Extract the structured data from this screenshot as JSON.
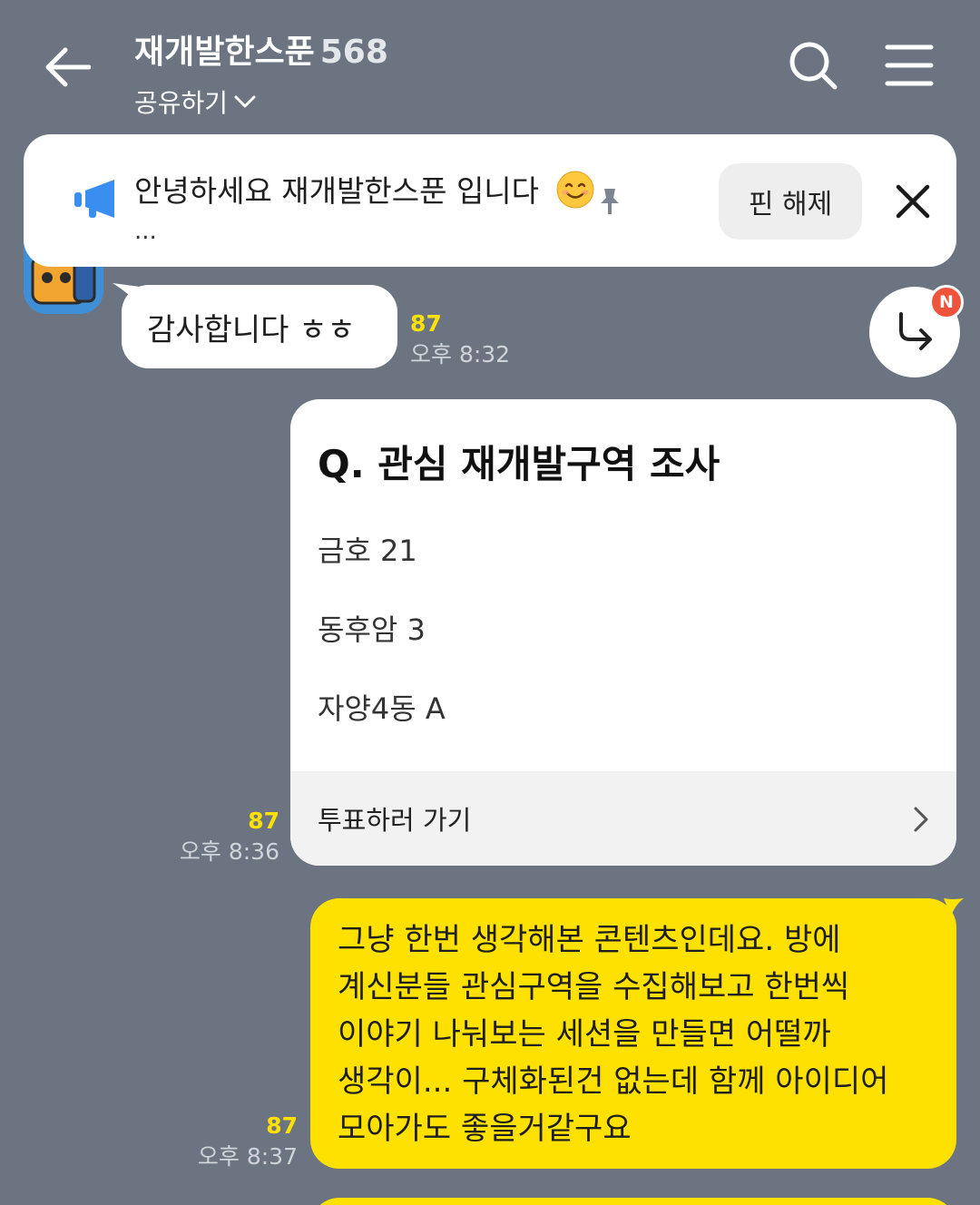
{
  "header": {
    "title": "재개발한스푼",
    "member_count": "568",
    "share_label": "공유하기"
  },
  "notice": {
    "text": "안녕하세요 재개발한스푼 입니다",
    "ellipsis": "...",
    "unpin_label": "핀 해제"
  },
  "messages": {
    "m1": {
      "text": "감사합니다 ㅎㅎ",
      "unread": "87",
      "time": "오후 8:32"
    },
    "poll": {
      "title": "Q. 관심 재개발구역 조사",
      "options": [
        "금호 21",
        "동후암 3",
        "자양4동 A"
      ],
      "action_label": "투표하러 가기",
      "unread": "87",
      "time": "오후 8:36"
    },
    "m3": {
      "lines": [
        "그냥 한번 생각해본 콘텐츠인데요. 방에",
        "계신분들 관심구역을 수집해보고 한번씩",
        "이야기 나눠보는 세션을 만들면 어떨까",
        "생각이... 구체화된건 없는데 함께 아이디어",
        "모아가도 좋을거같구요"
      ],
      "unread": "87",
      "time": "오후 8:37"
    }
  },
  "badge": {
    "new_label": "N"
  },
  "colors": {
    "background": "#6b7480",
    "my_bubble": "#ffe100",
    "unread": "#ffe100",
    "badge": "#f0533c"
  },
  "icons": [
    "back-arrow-icon",
    "search-icon",
    "menu-icon",
    "megaphone-icon",
    "smile-emoji-icon",
    "pin-icon",
    "close-icon",
    "reply-arrow-icon",
    "chevron-right-icon",
    "chevron-down-icon"
  ]
}
